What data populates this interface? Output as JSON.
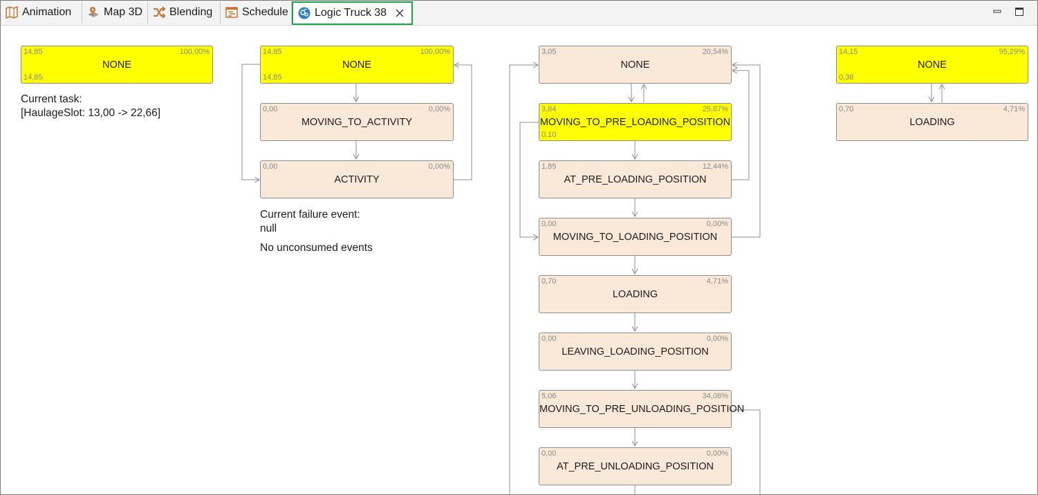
{
  "tabs": [
    {
      "label": "Animation",
      "icon": "map-icon"
    },
    {
      "label": "Map 3D",
      "icon": "map-3d-icon"
    },
    {
      "label": "Blending",
      "icon": "shuffle-icon"
    },
    {
      "label": "Schedule",
      "icon": "schedule-icon"
    },
    {
      "label": "Logic Truck 38",
      "icon": "logic-icon",
      "active": true
    }
  ],
  "diagram": {
    "col1": {
      "none": {
        "label": "NONE",
        "tl": "14,85",
        "tr": "100,00%",
        "bl": "14,85"
      },
      "task_label": "Current task:",
      "task_value": "[HaulageSlot: 13,00 -> 22,66]"
    },
    "col2": {
      "none": {
        "label": "NONE",
        "tl": "14,85",
        "tr": "100,00%",
        "bl": "14,85"
      },
      "moving": {
        "label": "MOVING_TO_ACTIVITY",
        "tl": "0,00",
        "tr": "0,00%"
      },
      "activity": {
        "label": "ACTIVITY",
        "tl": "0,00",
        "tr": "0,00%"
      },
      "failure_label": "Current failure event:",
      "failure_value": "null",
      "unconsumed": "No unconsumed events"
    },
    "col3": {
      "none": {
        "label": "NONE",
        "tl": "3,05",
        "tr": "20,54%"
      },
      "moving_pre_loading": {
        "label": "MOVING_TO_PRE_LOADING_POSITION",
        "tl": "3,84",
        "tr": "25,87%",
        "bl": "0,10"
      },
      "at_pre_loading": {
        "label": "AT_PRE_LOADING_POSITION",
        "tl": "1,85",
        "tr": "12,44%"
      },
      "moving_loading": {
        "label": "MOVING_TO_LOADING_POSITION",
        "tl": "0,00",
        "tr": "0,00%"
      },
      "loading": {
        "label": "LOADING",
        "tl": "0,70",
        "tr": "4,71%"
      },
      "leaving_loading": {
        "label": "LEAVING_LOADING_POSITION",
        "tl": "0,00",
        "tr": "0,00%"
      },
      "moving_pre_unloading": {
        "label": "MOVING_TO_PRE_UNLOADING_POSITION",
        "tl": "5,06",
        "tr": "34,08%"
      },
      "at_pre_unloading": {
        "label": "AT_PRE_UNLOADING_POSITION",
        "tl": "0,00",
        "tr": "0,00%"
      }
    },
    "col4": {
      "none": {
        "label": "NONE",
        "tl": "14,15",
        "tr": "95,29%",
        "bl": "0,38"
      },
      "loading": {
        "label": "LOADING",
        "tl": "0,70",
        "tr": "4,71%"
      }
    }
  },
  "colors": {
    "highlight": "#ffff00",
    "node": "#fae9d8",
    "active_tab_border": "#1ea34a"
  }
}
